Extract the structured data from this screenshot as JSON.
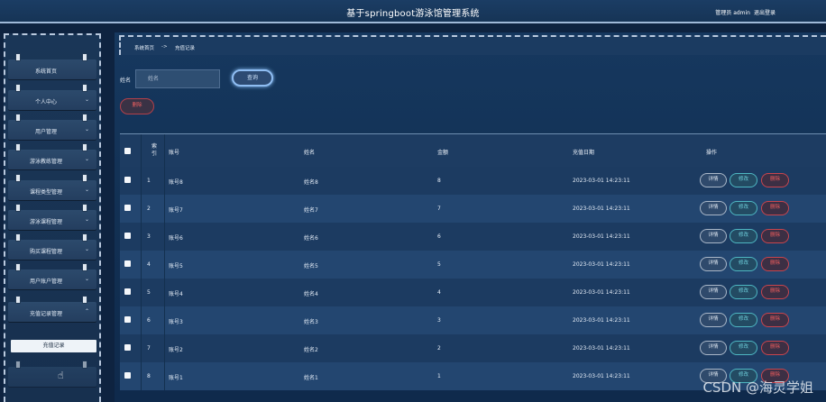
{
  "header": {
    "title": "基于springboot游泳馆管理系统",
    "user": "管理员 admin",
    "logout": "退出登录"
  },
  "sidebar": {
    "items": [
      {
        "label": "系统首页",
        "chevron": ""
      },
      {
        "label": "个人中心",
        "chevron": "⌄"
      },
      {
        "label": "用户管理",
        "chevron": "⌄"
      },
      {
        "label": "游泳教练管理",
        "chevron": "⌄"
      },
      {
        "label": "课程类型管理",
        "chevron": "⌄"
      },
      {
        "label": "游泳课程管理",
        "chevron": "⌄"
      },
      {
        "label": "购买课程管理",
        "chevron": "⌄"
      },
      {
        "label": "用户账户管理",
        "chevron": "⌄"
      },
      {
        "label": "充值记录管理",
        "chevron": "⌃"
      }
    ],
    "submenu": {
      "label": "充值记录"
    }
  },
  "breadcrumb": {
    "home": "系统首页",
    "arrow": "->",
    "current": "充值记录"
  },
  "search": {
    "label": "姓名",
    "placeholder": "姓名",
    "query_label": "查询"
  },
  "actions": {
    "delete_label": "删除"
  },
  "table": {
    "columns": {
      "index_line1": "索",
      "index_line2": "引",
      "account": "账号",
      "name": "姓名",
      "amount": "金额",
      "date": "充值日期",
      "ops": "操作"
    },
    "rows": [
      {
        "index": "1",
        "account": "账号8",
        "name": "姓名8",
        "amount": "8",
        "date": "2023-03-01 14:23:11"
      },
      {
        "index": "2",
        "account": "账号7",
        "name": "姓名7",
        "amount": "7",
        "date": "2023-03-01 14:23:11"
      },
      {
        "index": "3",
        "account": "账号6",
        "name": "姓名6",
        "amount": "6",
        "date": "2023-03-01 14:23:11"
      },
      {
        "index": "4",
        "account": "账号5",
        "name": "姓名5",
        "amount": "5",
        "date": "2023-03-01 14:23:11"
      },
      {
        "index": "5",
        "account": "账号4",
        "name": "姓名4",
        "amount": "4",
        "date": "2023-03-01 14:23:11"
      },
      {
        "index": "6",
        "account": "账号3",
        "name": "姓名3",
        "amount": "3",
        "date": "2023-03-01 14:23:11"
      },
      {
        "index": "7",
        "account": "账号2",
        "name": "姓名2",
        "amount": "2",
        "date": "2023-03-01 14:23:11"
      },
      {
        "index": "8",
        "account": "账号1",
        "name": "姓名1",
        "amount": "1",
        "date": "2023-03-01 14:23:11"
      }
    ],
    "row_actions": {
      "detail": "详情",
      "edit": "修改",
      "delete": "删除"
    }
  },
  "watermark": "CSDN @海灵学姐",
  "colors": {
    "background": "#0e2340",
    "accent_query": "#8fbdf2",
    "edit": "#4eb6c2",
    "delete": "#c8454e"
  }
}
